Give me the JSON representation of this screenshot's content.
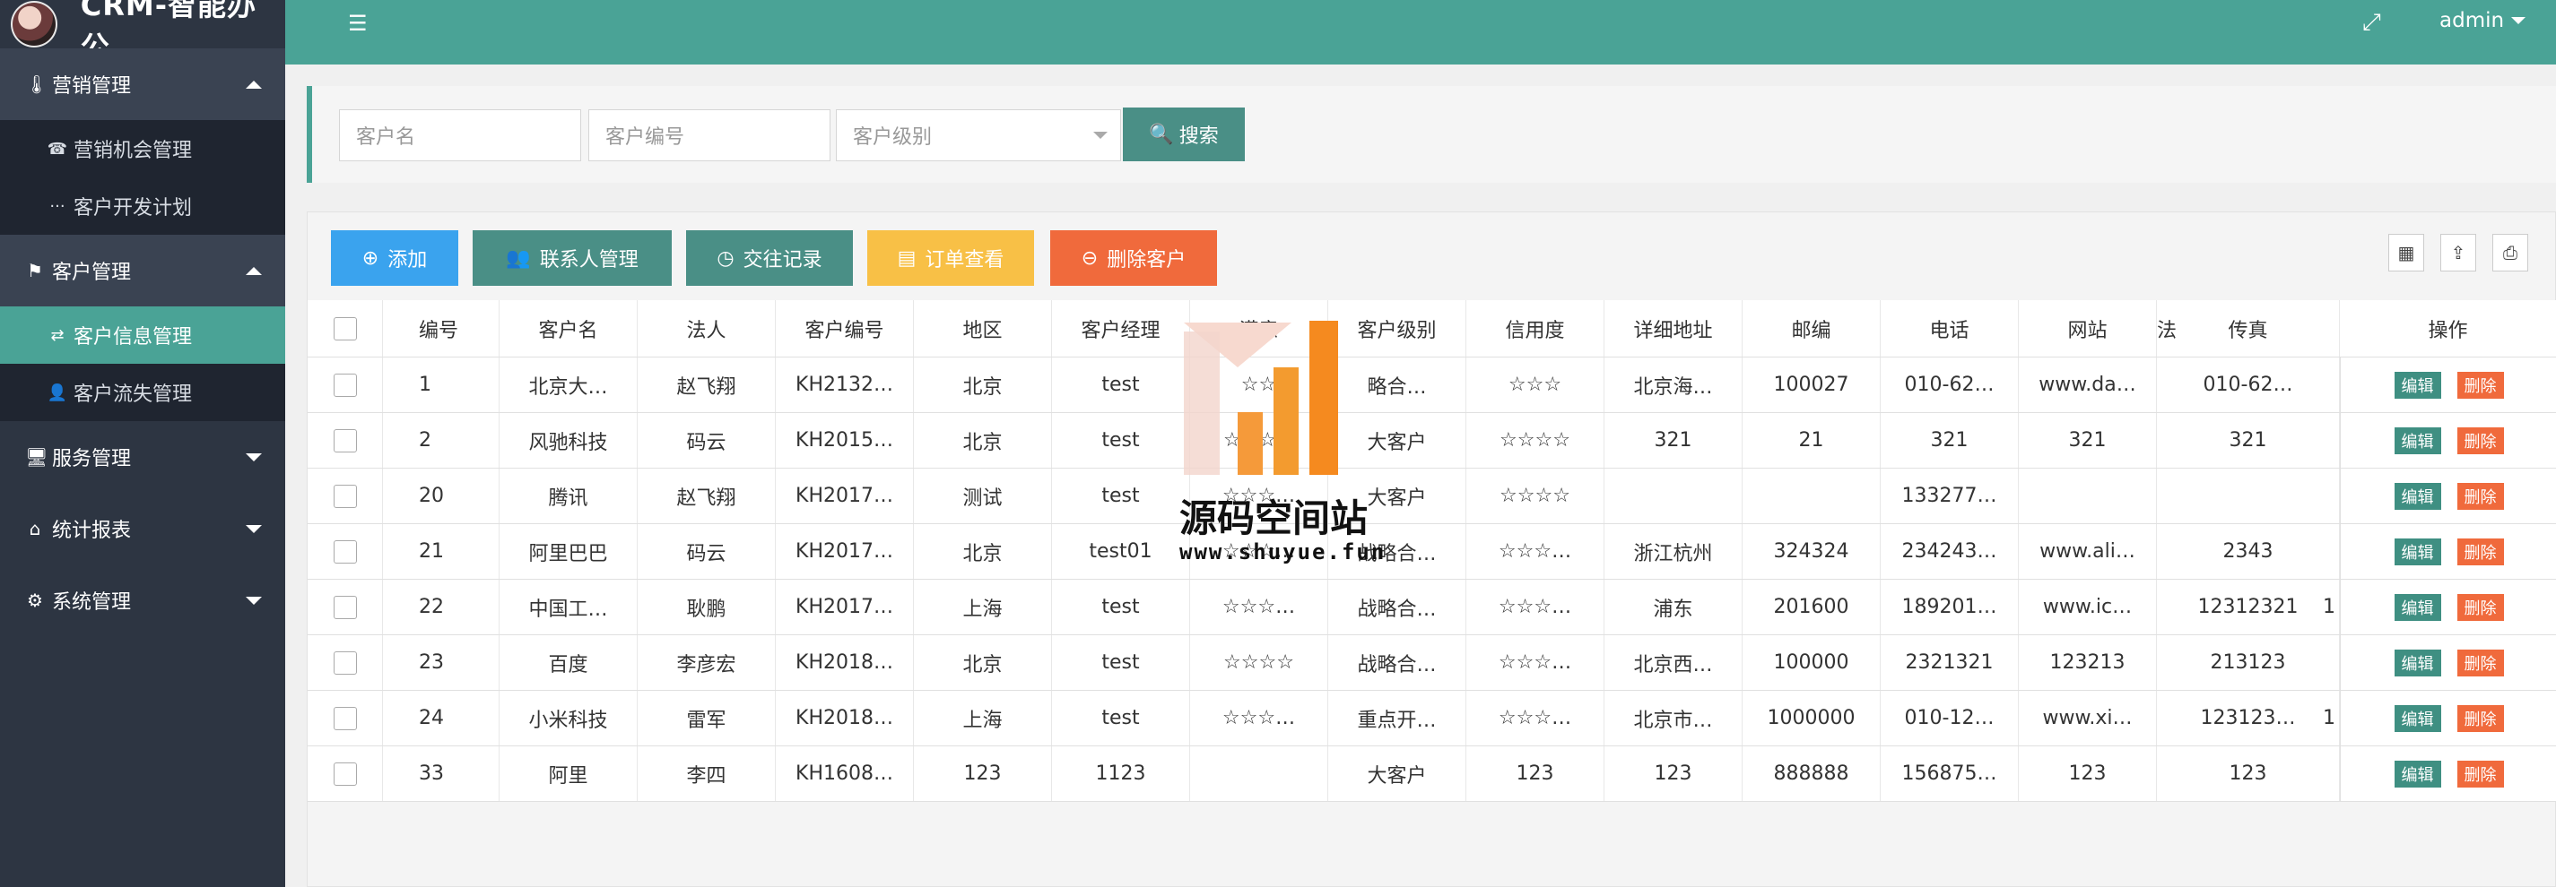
{
  "app": {
    "title": "CRM-智能办公",
    "user": "admin"
  },
  "sidebar": {
    "groups": [
      {
        "label": "营销管理",
        "icon": "tool-icon",
        "expanded": true,
        "items": [
          {
            "label": "营销机会管理",
            "icon": "opportunity-icon"
          },
          {
            "label": "客户开发计划",
            "icon": "dots-icon"
          }
        ]
      },
      {
        "label": "客户管理",
        "icon": "flag-icon",
        "expanded": true,
        "items": [
          {
            "label": "客户信息管理",
            "icon": "exchange-icon",
            "active": true
          },
          {
            "label": "客户流失管理",
            "icon": "user-lock-icon"
          }
        ]
      },
      {
        "label": "服务管理",
        "icon": "monitor-icon",
        "expanded": false
      },
      {
        "label": "统计报表",
        "icon": "home-icon",
        "expanded": false
      },
      {
        "label": "系统管理",
        "icon": "gears-icon",
        "expanded": false
      }
    ]
  },
  "search": {
    "name_placeholder": "客户名",
    "code_placeholder": "客户编号",
    "level_placeholder": "客户级别",
    "button_label": "搜索"
  },
  "toolbar": {
    "add": "添加",
    "contacts": "联系人管理",
    "records": "交往记录",
    "orders": "订单查看",
    "delete": "删除客户",
    "colors": {
      "add": "#3aa3ee",
      "contacts": "#4a8f86",
      "records": "#4a8f86",
      "orders": "#f8c046",
      "delete": "#f06a3c"
    }
  },
  "table": {
    "headers": [
      "编号",
      "客户名",
      "法人",
      "客户编号",
      "地区",
      "客户经理",
      "满意",
      "客户级别",
      "信用度",
      "详细地址",
      "邮编",
      "电话",
      "网站",
      "传真",
      "法",
      "操作"
    ],
    "edit_label": "编辑",
    "delete_label": "删除",
    "rows": [
      [
        "1",
        "北京大…",
        "赵飞翔",
        "KH2132…",
        "北京",
        "test",
        "☆☆",
        "略合…",
        "☆☆☆",
        "北京海…",
        "100027",
        "010-62…",
        "www.da…",
        "010-62…",
        ""
      ],
      [
        "2",
        "风驰科技",
        "码云",
        "KH2015…",
        "北京",
        "test",
        "☆☆☆☆",
        "大客户",
        "☆☆☆☆",
        "321",
        "21",
        "321",
        "321",
        "321",
        ""
      ],
      [
        "20",
        "腾讯",
        "赵飞翔",
        "KH2017…",
        "测试",
        "test",
        "☆☆☆…",
        "大客户",
        "☆☆☆☆",
        "",
        "",
        "133277…",
        "",
        "",
        ""
      ],
      [
        "21",
        "阿里巴巴",
        "码云",
        "KH2017…",
        "北京",
        "test01",
        "☆☆☆…",
        "战略合…",
        "☆☆☆…",
        "浙江杭州",
        "324324",
        "234243…",
        "www.ali…",
        "2343",
        ""
      ],
      [
        "22",
        "中国工…",
        "耿鹏",
        "KH2017…",
        "上海",
        "test",
        "☆☆☆…",
        "战略合…",
        "☆☆☆…",
        "浦东",
        "201600",
        "189201…",
        "www.ic…",
        "12312321",
        "1"
      ],
      [
        "23",
        "百度",
        "李彦宏",
        "KH2018…",
        "北京",
        "test",
        "☆☆☆☆",
        "战略合…",
        "☆☆☆…",
        "北京西…",
        "100000",
        "2321321",
        "123213",
        "213123",
        ""
      ],
      [
        "24",
        "小米科技",
        "雷军",
        "KH2018…",
        "上海",
        "test",
        "☆☆☆…",
        "重点开…",
        "☆☆☆…",
        "北京市…",
        "1000000",
        "010-12…",
        "www.xi…",
        "123123…",
        "1"
      ],
      [
        "33",
        "阿里",
        "李四",
        "KH1608…",
        "123",
        "1123",
        "",
        "大客户",
        "123",
        "123",
        "888888",
        "156875…",
        "123",
        "123",
        ""
      ]
    ]
  },
  "watermark": {
    "title": "源码空间站",
    "url": "www.shuyue.fun"
  },
  "colors": {
    "primary": "#4aa396",
    "sidebar": "#2d3542",
    "sidebar_dark": "#1f2530"
  }
}
